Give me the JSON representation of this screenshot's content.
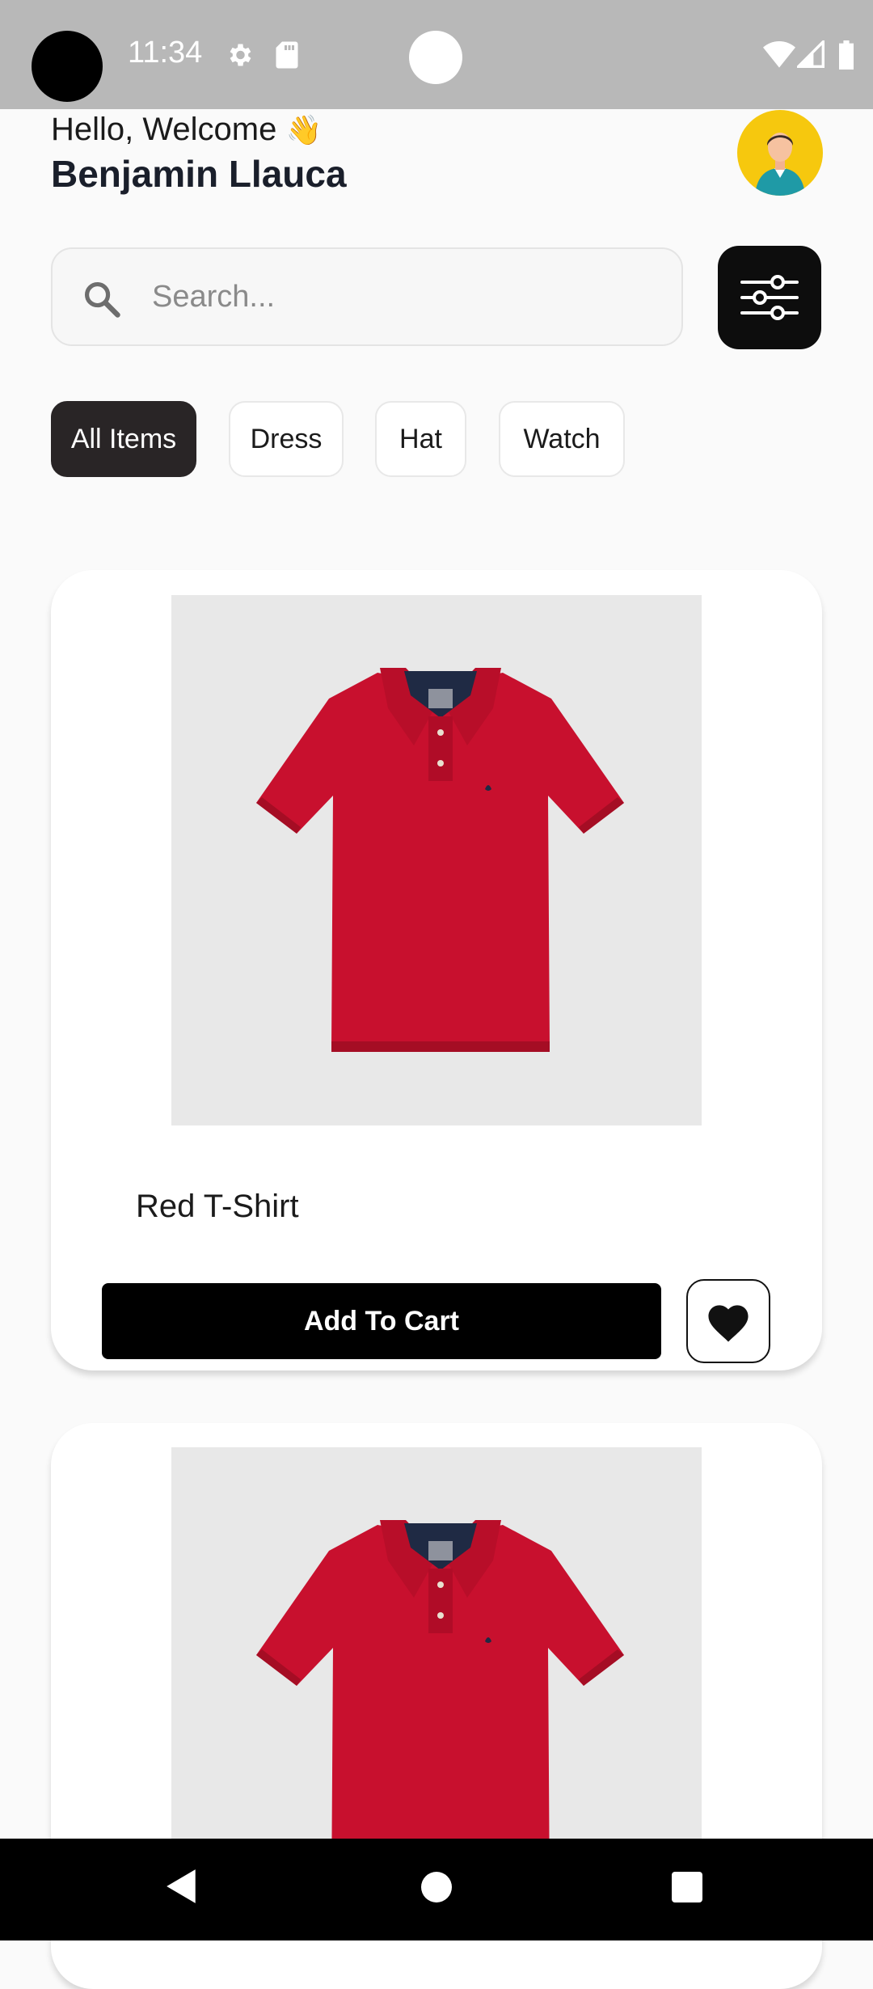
{
  "status_bar": {
    "time": "11:34",
    "icons": [
      "gear-icon",
      "sd-card-icon",
      "wifi-icon",
      "signal-icon",
      "battery-icon"
    ]
  },
  "header": {
    "greeting": "Hello, Welcome",
    "greeting_emoji": "👋",
    "user_name": "Benjamin Llauca",
    "avatar_icon": "user-avatar-icon"
  },
  "search": {
    "placeholder": "Search...",
    "value": ""
  },
  "categories": [
    {
      "label": "All Items",
      "selected": true
    },
    {
      "label": "Dress",
      "selected": false
    },
    {
      "label": "Hat",
      "selected": false
    },
    {
      "label": "Watch",
      "selected": false
    }
  ],
  "products": [
    {
      "name": "Red T-Shirt",
      "add_to_cart_label": "Add To Cart",
      "favorite_icon": "heart-icon",
      "image": "red-polo-shirt"
    },
    {
      "name": "",
      "image": "red-polo-shirt"
    }
  ],
  "colors": {
    "accent_dark": "#0d0d0d",
    "chip_active": "#292526",
    "shirt_red": "#c8102e",
    "avatar_bg": "#f6c80e"
  }
}
